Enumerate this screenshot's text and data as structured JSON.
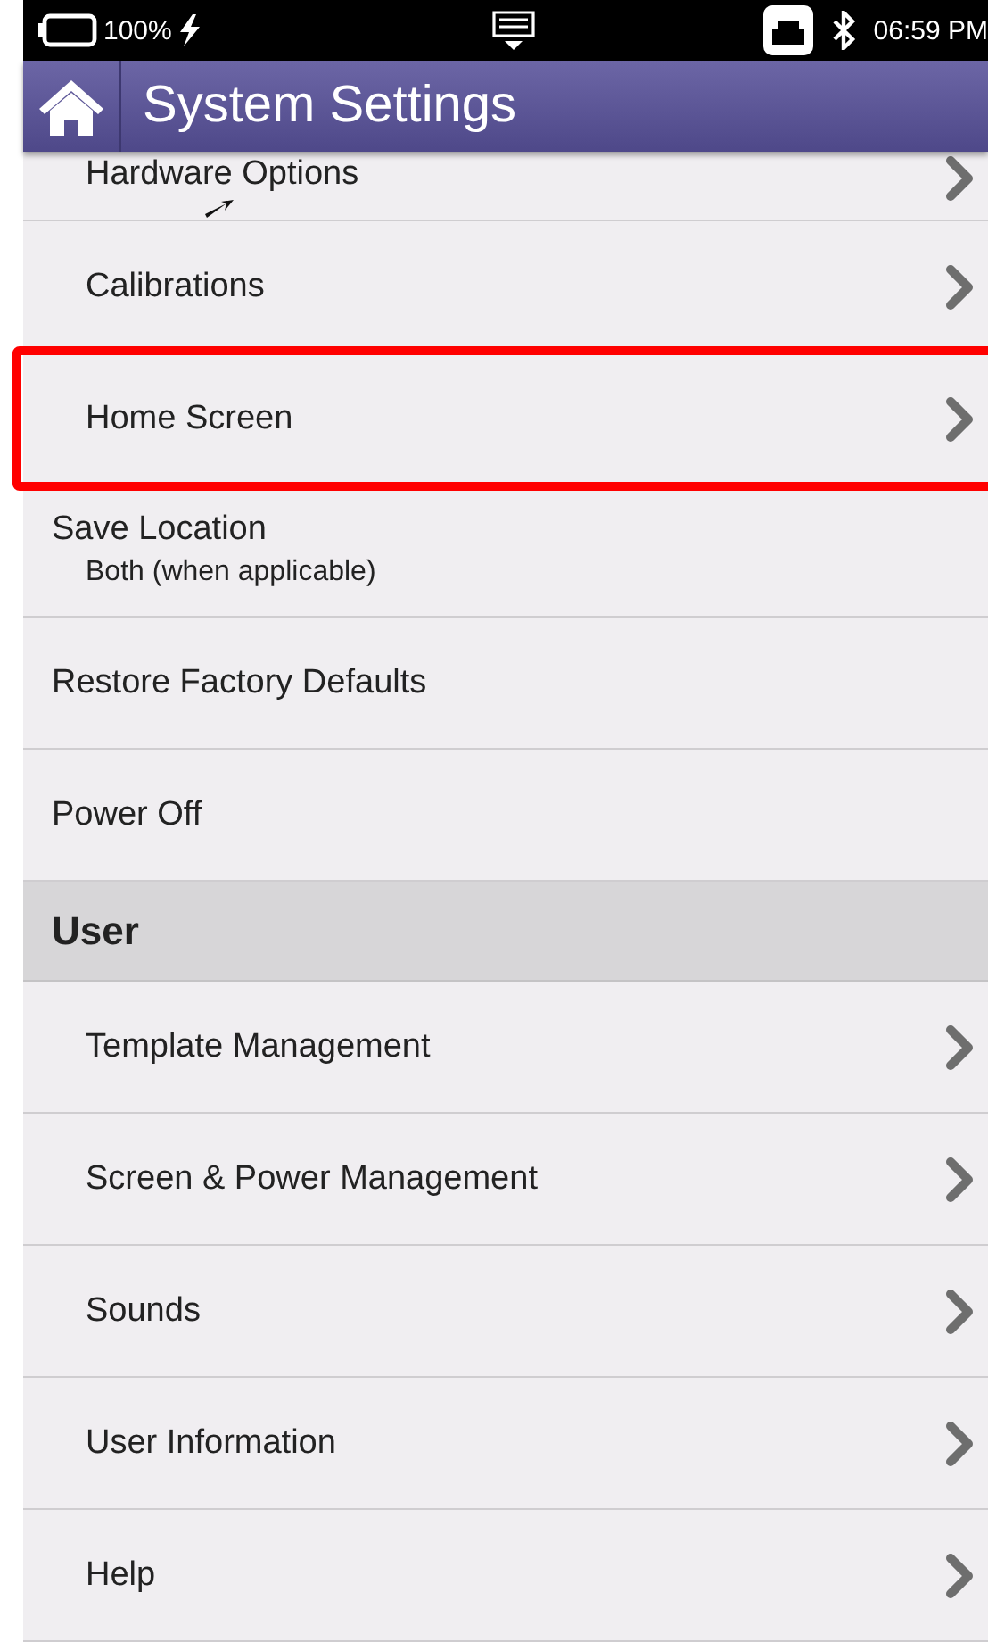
{
  "status_bar": {
    "battery": "100%",
    "time": "06:59 PM"
  },
  "header": {
    "title": "System Settings"
  },
  "items": [
    {
      "kind": "link",
      "label": "Hardware Options",
      "highlighted": false
    },
    {
      "kind": "link",
      "label": "Calibrations",
      "highlighted": false
    },
    {
      "kind": "link",
      "label": "Home Screen",
      "highlighted": true
    },
    {
      "kind": "setting",
      "label": "Save Location",
      "value": "Both (when applicable)",
      "highlighted": false
    },
    {
      "kind": "action",
      "label": "Restore Factory Defaults",
      "highlighted": false
    },
    {
      "kind": "action",
      "label": "Power Off",
      "highlighted": false
    },
    {
      "kind": "section",
      "label": "User"
    },
    {
      "kind": "link",
      "label": "Template Management",
      "highlighted": false
    },
    {
      "kind": "link",
      "label": "Screen & Power Management",
      "highlighted": false
    },
    {
      "kind": "link",
      "label": "Sounds",
      "highlighted": false
    },
    {
      "kind": "link",
      "label": "User Information",
      "highlighted": false
    },
    {
      "kind": "link",
      "label": "Help",
      "highlighted": false
    }
  ]
}
